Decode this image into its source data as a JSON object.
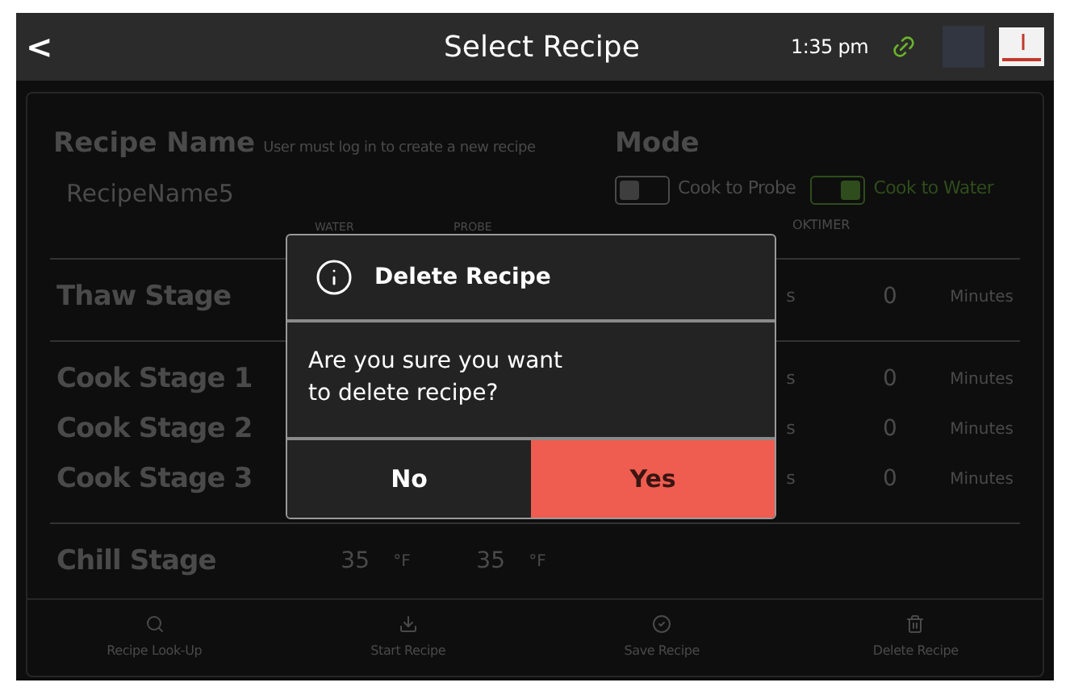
{
  "header": {
    "back": "<",
    "title": "Select Recipe",
    "time": "1:35 pm"
  },
  "recipe": {
    "label": "Recipe Name",
    "note": "User must log in to create a new recipe",
    "name": "RecipeName5"
  },
  "mode": {
    "label": "Mode",
    "options": [
      {
        "label": "Cook to Probe",
        "selected": false
      },
      {
        "label": "Cook to Water",
        "selected": true
      }
    ]
  },
  "column_headers": [
    "WATER",
    "PROBE",
    "OKTIMER"
  ],
  "stages": [
    {
      "kind": "timed",
      "name": "Thaw Stage",
      "fragment": "s",
      "time": "0",
      "time_unit": "Minutes",
      "divider_after": true
    },
    {
      "kind": "timed",
      "name": "Cook Stage 1",
      "fragment": "s",
      "time": "0",
      "time_unit": "Minutes",
      "divider_after": false
    },
    {
      "kind": "timed",
      "name": "Cook Stage 2",
      "fragment": "s",
      "time": "0",
      "time_unit": "Minutes",
      "divider_after": false
    },
    {
      "kind": "timed",
      "name": "Cook Stage 3",
      "fragment": "s",
      "time": "0",
      "time_unit": "Minutes",
      "divider_after": true
    },
    {
      "kind": "chill",
      "name": "Chill Stage",
      "water": "35",
      "water_unit": "°F",
      "probe": "35",
      "probe_unit": "°F",
      "divider_after": false
    }
  ],
  "toolbar": [
    {
      "label": "Recipe Look-Up"
    },
    {
      "label": "Start Recipe"
    },
    {
      "label": "Save Recipe"
    },
    {
      "label": "Delete Recipe"
    }
  ],
  "dialog": {
    "title": "Delete Recipe",
    "message": "Are you sure you want\nto delete recipe?",
    "buttons": [
      {
        "kind": "cancel",
        "label": "No"
      },
      {
        "kind": "confirm",
        "label": "Yes"
      }
    ]
  }
}
